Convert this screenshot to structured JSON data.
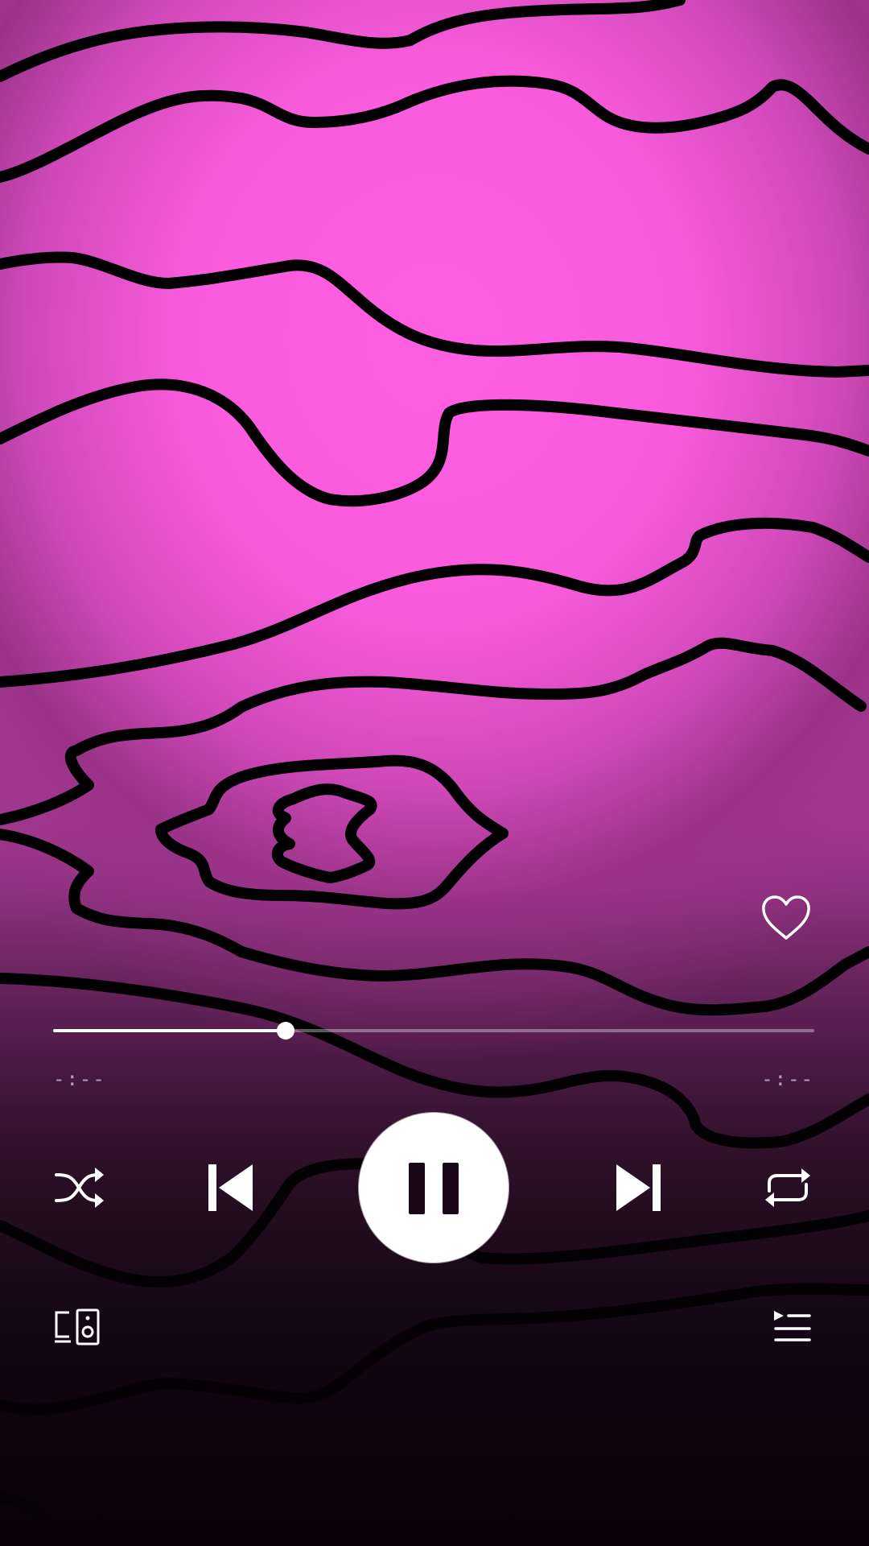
{
  "player": {
    "accent_color": "#ffffff",
    "artwork": {
      "background_color": "#ff5fe3",
      "line_color": "#000000"
    },
    "progress_fraction": 0.305,
    "time_elapsed": "-:--",
    "time_total": "-:--",
    "state": "playing",
    "icons": {
      "like": "heart-outline-icon",
      "shuffle": "shuffle-icon",
      "previous": "skip-previous-icon",
      "play_pause": "pause-icon",
      "next": "skip-next-icon",
      "repeat": "repeat-icon",
      "devices": "connect-devices-icon",
      "queue": "queue-icon"
    }
  }
}
